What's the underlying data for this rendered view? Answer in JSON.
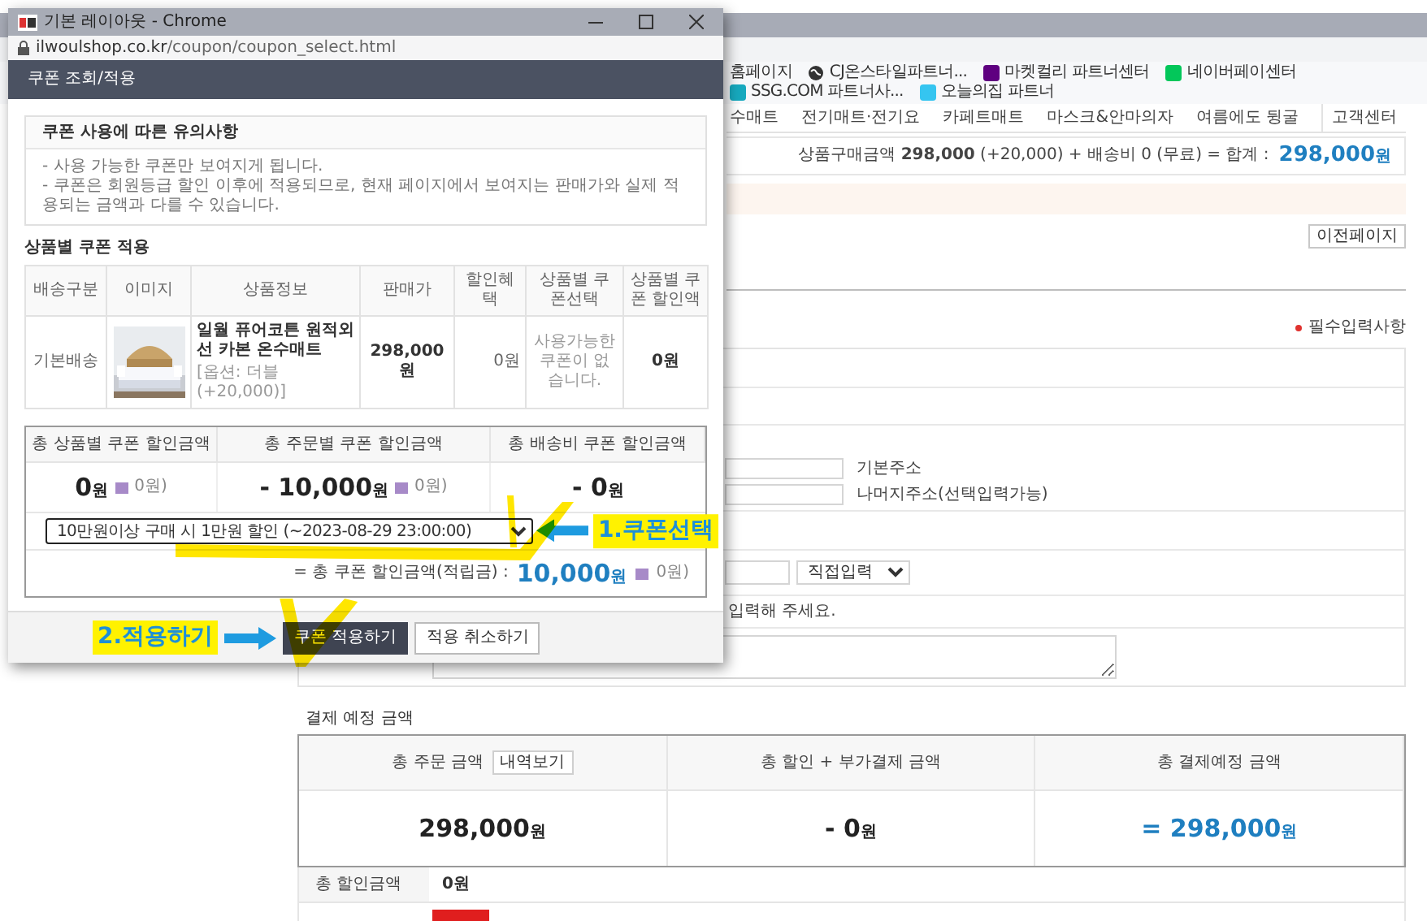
{
  "background_window": {
    "bookmarks": [
      {
        "label": "홈페이지",
        "kind": "plain"
      },
      {
        "label": "CJ온스타일파트너...",
        "kind": "globe"
      },
      {
        "label": "마켓컬리 파트너센터",
        "kind": "tile",
        "color": "#5f0080"
      },
      {
        "label": "네이버페이센터",
        "kind": "tile",
        "color": "#03c75a"
      },
      {
        "label": "SSG.COM 파트너사...",
        "kind": "tile",
        "color": "#17a9be"
      },
      {
        "label": "오늘의집 파트너",
        "kind": "tile",
        "color": "#35c5f0"
      }
    ],
    "nav_menu": [
      "수매트",
      "전기매트·전기요",
      "카페트매트",
      "마스크&안마의자",
      "여름에도 뒹굴"
    ],
    "customer_center": "고객센터",
    "cart_summary": {
      "text": "상품구매금액 **298,000** (+20,000) + 배송비 0 (무료) = 합계 :",
      "amount": "298,000",
      "unit": "원"
    },
    "prev_page_button": "이전페이지",
    "required_note": "필수입력사항",
    "address_fields": [
      {
        "label": "기본주소"
      },
      {
        "label": "나머지주소(선택입력가능)"
      }
    ],
    "email_domain_select": "직접입력",
    "message_hint": "입력해 주세요.",
    "payment": {
      "title": "결제 예정 금액",
      "columns": [
        {
          "label": "총 주문 금액",
          "button": "내역보기",
          "amount": "298,000",
          "unit": "원",
          "kind": "plain"
        },
        {
          "label": "총 할인 + 부가결제 금액",
          "amount": "- 0",
          "unit": "원",
          "kind": "plain"
        },
        {
          "label": "총 결제예정 금액",
          "amount": "= 298,000",
          "unit": "원",
          "kind": "total"
        }
      ],
      "discount_row": {
        "label": "총 할인금액",
        "value": "0원"
      }
    }
  },
  "popup": {
    "title": "기본 레이아웃 - Chrome",
    "url": "ilwoulshop.co.kr/coupon/coupon_select.html",
    "header": "쿠폰 조회/적용",
    "notice": {
      "title": "쿠폰 사용에 따른 유의사항",
      "lines": [
        "- 사용 가능한 쿠폰만 보여지게 됩니다.",
        "- 쿠폰은 회원등급 할인 이후에 적용되므로, 현재 페이지에서 보여지는 판매가와 실제 적용되는 금액과 다를 수 있습니다."
      ]
    },
    "product_section_title": "상품별 쿠폰 적용",
    "product_table": {
      "columns": [
        "배송구분",
        "이미지",
        "상품정보",
        "판매가",
        "할인혜택",
        "상품별 쿠폰선택",
        "상품별 쿠폰 할인액"
      ],
      "rows": [
        {
          "shipping": "기본배송",
          "name": "일월 퓨어코튼 원적외선 카본 온수매트",
          "option": "[옵션: 더블 (+20,000)]",
          "price": "298,000원",
          "benefit": "0원",
          "coupon": "사용가능한 쿠폰이 없습니다.",
          "discount": "0원"
        }
      ]
    },
    "summary": {
      "columns": [
        {
          "label": "총 상품별 쿠폰 할인금액",
          "amount": "0",
          "unit": "원",
          "points": "0원)"
        },
        {
          "label": "총 주문별 쿠폰 할인금액",
          "amount": "- 10,000",
          "unit": "원",
          "points": "0원)"
        },
        {
          "label": "총 배송비 쿠폰 할인금액",
          "amount": "- 0",
          "unit": "원"
        }
      ],
      "coupon_select": "10만원이상 구매 시 1만원 할인 (~2023-08-29 23:00:00)",
      "total": {
        "label": "= 총 쿠폰 할인금액(적립금) :",
        "amount": "10,000",
        "unit": "원",
        "points": "0원)"
      }
    },
    "buttons": [
      {
        "label": "쿠폰 적용하기",
        "kind": "primary"
      },
      {
        "label": "적용 취소하기",
        "kind": "secondary"
      }
    ]
  },
  "annotations": [
    {
      "text": "1.쿠폰선택"
    },
    {
      "text": "2.적용하기"
    }
  ]
}
